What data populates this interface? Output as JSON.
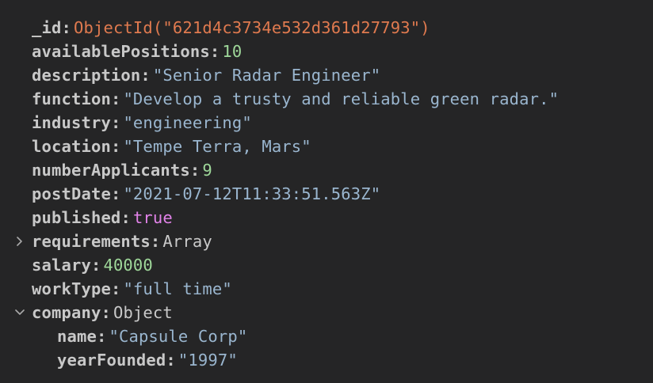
{
  "document": {
    "fields": [
      {
        "key": "_id",
        "value": "ObjectId(\"621d4c3734e532d361d27793\")",
        "type": "objectid"
      },
      {
        "key": "availablePositions",
        "value": "10",
        "type": "number"
      },
      {
        "key": "description",
        "value": "\"Senior Radar Engineer\"",
        "type": "string"
      },
      {
        "key": "function",
        "value": "\"Develop a trusty and reliable green radar.\"",
        "type": "string"
      },
      {
        "key": "industry",
        "value": "\"engineering\"",
        "type": "string"
      },
      {
        "key": "location",
        "value": "\"Tempe Terra, Mars\"",
        "type": "string"
      },
      {
        "key": "numberApplicants",
        "value": "9",
        "type": "number"
      },
      {
        "key": "postDate",
        "value": "\"2021-07-12T11:33:51.563Z\"",
        "type": "string"
      },
      {
        "key": "published",
        "value": "true",
        "type": "boolean"
      },
      {
        "key": "requirements",
        "value": "Array",
        "type": "array",
        "expanded": false
      },
      {
        "key": "salary",
        "value": "40000",
        "type": "number"
      },
      {
        "key": "workType",
        "value": "\"full time\"",
        "type": "string"
      },
      {
        "key": "company",
        "value": "Object",
        "type": "object",
        "expanded": true,
        "children": [
          {
            "key": "name",
            "value": "\"Capsule Corp\"",
            "type": "string"
          },
          {
            "key": "yearFounded",
            "value": "\"1997\"",
            "type": "string"
          }
        ]
      }
    ]
  },
  "colors": {
    "background": "#252526",
    "key": "#c8c8c8",
    "objectid": "#e07a4f",
    "number": "#9fd89a",
    "string": "#9ab6cf",
    "boolean": "#e283e9",
    "type": "#c9c9c9"
  },
  "icons": {
    "collapsed": "chevron-right-icon",
    "expanded": "chevron-down-icon"
  }
}
